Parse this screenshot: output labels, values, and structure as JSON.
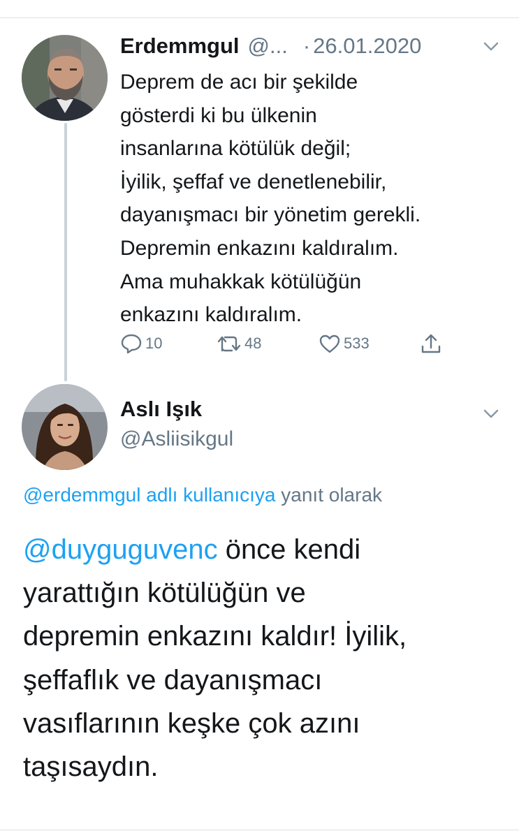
{
  "tweet1": {
    "name": "Erdemmgul",
    "handle_truncated": "@...",
    "separator": "·",
    "date": "26.01.2020",
    "lines": [
      "Deprem de acı bir şekilde",
      "gösterdi ki bu ülkenin",
      "insanlarına kötülük değil;",
      "İyilik, şeffaf ve denetlenebilir,",
      "dayanışmacı bir yönetim gerekli.",
      "Depremin enkazını kaldıralım.",
      "Ama muhakkak kötülüğün",
      "enkazını kaldıralım."
    ],
    "actions": {
      "replies": "10",
      "retweets": "48",
      "likes": "533"
    }
  },
  "tweet2": {
    "name": "Aslı Işık",
    "handle": "@Asliisikgul",
    "reply_context": {
      "link": "@erdemmgul adlı kullanıcıya",
      "suffix": "yanıt olarak"
    },
    "mention": "@duyguguvenc",
    "lines": [
      " önce kendi",
      "yarattığın kötülüğün ve",
      "depremin enkazını kaldır! İyilik,",
      "şeffaflık ve dayanışmacı",
      "vasıflarının keşke çok azını",
      "taşısaydın."
    ]
  },
  "colors": {
    "text": "#14171a",
    "secondary": "#657786",
    "link": "#1da1f2",
    "divider": "#dbe1e6",
    "thread_line": "#c9d2da"
  },
  "icons": [
    "reply-icon",
    "retweet-icon",
    "like-icon",
    "share-icon",
    "chevron-down-icon"
  ]
}
